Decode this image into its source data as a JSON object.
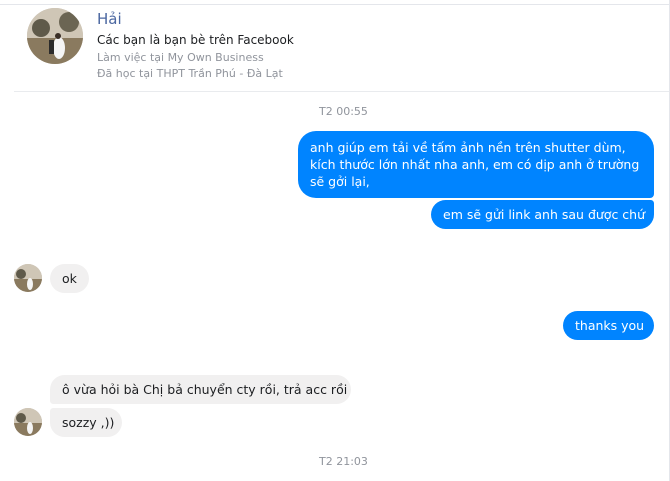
{
  "header": {
    "name": "Hải",
    "friend_status": "Các bạn là bạn bè trên Facebook",
    "work": "Làm việc tại My Own Business",
    "education": "Đã học tại THPT Trần Phú - Đà Lạt"
  },
  "timestamps": {
    "first": "T2 00:55",
    "second": "T2 21:03"
  },
  "messages": [
    {
      "text": "anh giúp em tải về tấm ảnh nền trên shutter dùm, kích thước lớn nhất nha anh, em có dịp anh ở trường sẽ gởi lại,"
    },
    {
      "text": "em sẽ gửi link anh sau được chứ"
    },
    {
      "text": "ok"
    },
    {
      "text": "thanks you"
    },
    {
      "text": "ô vừa hỏi bà Chị bả chuyển cty rồi, trả acc rồi"
    },
    {
      "text": "sozzy ,))"
    }
  ],
  "colors": {
    "outgoing": "#0084ff",
    "incoming": "#f1f0f0",
    "name": "#4b67a1"
  }
}
